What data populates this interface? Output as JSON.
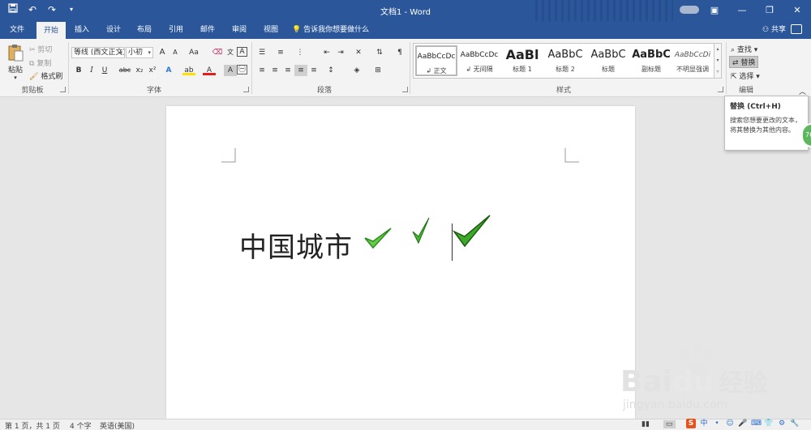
{
  "window": {
    "title": "文档1 - Word"
  },
  "titlebar": {
    "save_icon": "save-icon",
    "undo_icon": "undo-icon",
    "redo_icon": "redo-icon"
  },
  "tabs": [
    {
      "label": "文件"
    },
    {
      "label": "开始"
    },
    {
      "label": "插入"
    },
    {
      "label": "设计"
    },
    {
      "label": "布局"
    },
    {
      "label": "引用"
    },
    {
      "label": "邮件"
    },
    {
      "label": "审阅"
    },
    {
      "label": "视图"
    }
  ],
  "tell_me": "告诉我你想要做什么",
  "share": "共享",
  "clipboard": {
    "paste": "粘贴",
    "cut": "剪切",
    "copy": "复制",
    "format_painter": "格式刷",
    "group": "剪贴板"
  },
  "font": {
    "name": "等线 (西文正文)",
    "size": "小初",
    "case_btn": "Aa",
    "group": "字体",
    "bold": "B",
    "italic": "I",
    "underline": "U",
    "strike": "abc",
    "subscript": "x₂",
    "superscript": "x²",
    "font_color": "A",
    "char_shade": "A",
    "grow": "A",
    "shrink": "A",
    "highlight": "ab",
    "phonetic": "文",
    "border_char": "A"
  },
  "paragraph": {
    "group": "段落"
  },
  "styles": {
    "group": "样式",
    "items": [
      {
        "preview": "AaBbCcDc",
        "name": "正文"
      },
      {
        "preview": "AaBbCcDc",
        "name": "无间隔"
      },
      {
        "preview": "AaBl",
        "name": "标题 1"
      },
      {
        "preview": "AaBbC",
        "name": "标题 2"
      },
      {
        "preview": "AaBbC",
        "name": "标题"
      },
      {
        "preview": "AaBbC",
        "name": "副标题"
      },
      {
        "preview": "AaBbCcDi",
        "name": "不明显强调"
      }
    ]
  },
  "editing": {
    "find": "查找",
    "replace": "替换",
    "select": "选择",
    "group": "编辑"
  },
  "tooltip": {
    "title": "替换 (Ctrl+H)",
    "body": "搜索您想要更改的文本，将其替换为其他内容。"
  },
  "badge": "76",
  "document": {
    "text": "中国城市"
  },
  "status": {
    "page": "第 1 页，共 1 页",
    "words": "4 个字",
    "language": "英语(美国)"
  },
  "ime": {
    "chinese": "中"
  },
  "watermark": {
    "brand": "Bai",
    "brand2": "du",
    "cn": "经验",
    "url": "jingyan.baidu.com"
  },
  "colors": {
    "accent": "#2b579a",
    "check_light": "#66cc44",
    "check_dark": "#2e8b1f"
  }
}
